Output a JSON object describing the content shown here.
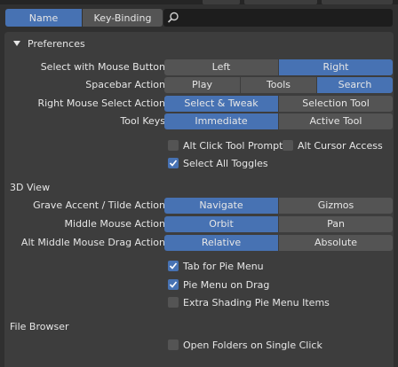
{
  "tabs": {
    "name": "Name",
    "key_binding": "Key-Binding"
  },
  "search": {
    "placeholder": ""
  },
  "preferences": {
    "title": "Preferences",
    "rows": [
      {
        "label": "Select with Mouse Button",
        "options": [
          "Left",
          "Right"
        ],
        "selected": "Right"
      },
      {
        "label": "Spacebar Action",
        "options": [
          "Play",
          "Tools",
          "Search"
        ],
        "selected": "Search"
      },
      {
        "label": "Right Mouse Select Action",
        "options": [
          "Select & Tweak",
          "Selection Tool"
        ],
        "selected": "Select & Tweak"
      },
      {
        "label": "Tool Keys",
        "options": [
          "Immediate",
          "Active Tool"
        ],
        "selected": "Immediate"
      }
    ],
    "checks": {
      "alt_click": {
        "label": "Alt Click Tool Prompt",
        "checked": false
      },
      "alt_cursor": {
        "label": "Alt Cursor Access",
        "checked": false
      },
      "select_all": {
        "label": "Select All Toggles",
        "checked": true
      }
    }
  },
  "view3d": {
    "title": "3D View",
    "rows": [
      {
        "label": "Grave Accent / Tilde Action",
        "options": [
          "Navigate",
          "Gizmos"
        ],
        "selected": "Navigate"
      },
      {
        "label": "Middle Mouse Action",
        "options": [
          "Orbit",
          "Pan"
        ],
        "selected": "Orbit"
      },
      {
        "label": "Alt Middle Mouse Drag Action",
        "options": [
          "Relative",
          "Absolute"
        ],
        "selected": "Relative"
      }
    ],
    "checks": {
      "tab_pie": {
        "label": "Tab for Pie Menu",
        "checked": true
      },
      "pie_drag": {
        "label": "Pie Menu on Drag",
        "checked": true
      },
      "extra_shading": {
        "label": "Extra Shading Pie Menu Items",
        "checked": false
      }
    }
  },
  "file_browser": {
    "title": "File Browser",
    "checks": {
      "open_single": {
        "label": "Open Folders on Single Click",
        "checked": false
      }
    }
  },
  "colors": {
    "accent": "#4772b3",
    "panel": "#3d3d3d",
    "button": "#545454",
    "background": "#303030"
  }
}
